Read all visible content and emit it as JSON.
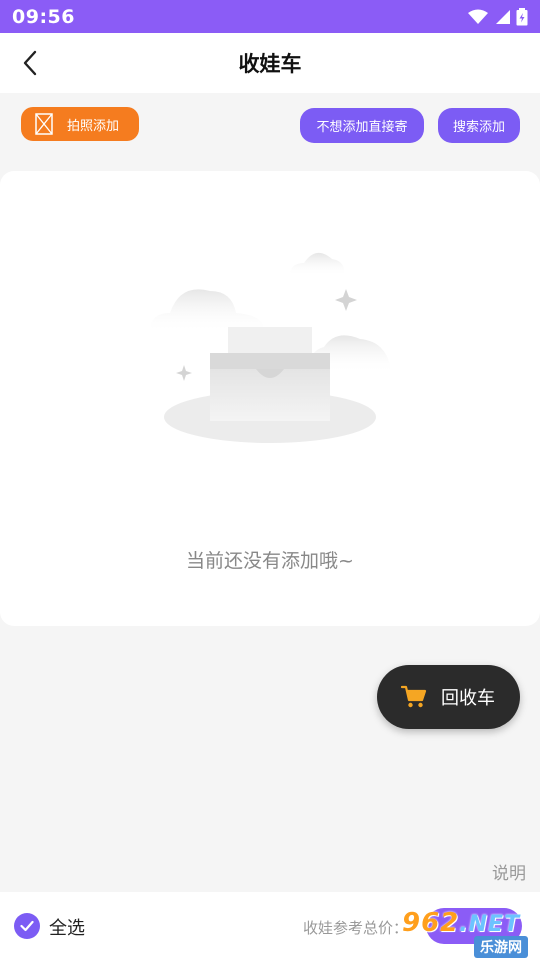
{
  "status_bar": {
    "time": "09:56"
  },
  "header": {
    "title": "收娃车"
  },
  "toolbar": {
    "photo_add": "拍照添加",
    "direct_send": "不想添加直接寄",
    "search_add": "搜索添加"
  },
  "empty_state": {
    "message": "当前还没有添加哦~"
  },
  "cart_fab": {
    "label": "回收车"
  },
  "explain_link": "说明",
  "bottom_bar": {
    "select_all": "全选",
    "total_label": "收娃参考总价："
  },
  "watermark": {
    "brand_num": "962",
    "brand_net": ".NET",
    "brand_sub": "乐游网"
  },
  "colors": {
    "primary": "#7c5cf4",
    "status_bar": "#8b5cf6",
    "orange": "#f57c1f",
    "fab": "#2b2b2b",
    "cart_icon": "#f5a623"
  },
  "icons": [
    "back-arrow-icon",
    "wifi-icon",
    "signal-icon",
    "battery-icon",
    "camera-placeholder-icon",
    "cart-icon",
    "check-icon",
    "empty-box-illustration"
  ]
}
